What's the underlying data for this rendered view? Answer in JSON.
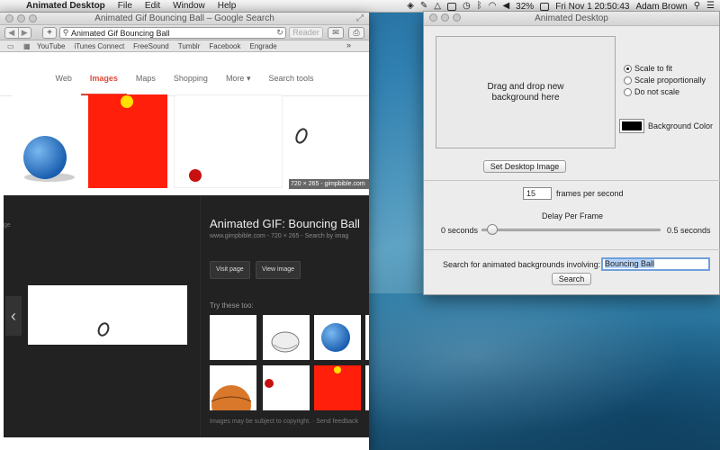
{
  "menubar": {
    "app_name": "Animated Desktop",
    "items": [
      "File",
      "Edit",
      "Window",
      "Help"
    ],
    "battery": "32%",
    "datetime": "Fri Nov 1  20:50:43",
    "user": "Adam Brown"
  },
  "browser": {
    "window_title": "Animated Gif Bouncing Ball – Google Search",
    "url_text": "Animated Gif Bouncing Ball",
    "reader_label": "Reader",
    "bookmarks": [
      "YouTube",
      "iTunes Connect",
      "FreeSound",
      "Tumblr",
      "Facebook",
      "Engrade"
    ],
    "google_tabs": [
      "Web",
      "Images",
      "Maps",
      "Shopping",
      "More ▾",
      "Search tools"
    ],
    "active_tab": "Images",
    "thumb_caption": "720 × 265 - gimpbible.com",
    "preview": {
      "left_edge_text": "ge",
      "title": "Animated GIF: Bouncing Ball",
      "subtitle": "www.gimpbible.com - 720 × 265 - Search by imag",
      "visit_label": "Visit page",
      "view_label": "View image",
      "try_these": "Try these too:",
      "footer": "Images may be subject to copyright.  ·  Send feedback"
    }
  },
  "desktop_app": {
    "window_title": "Animated Desktop",
    "dropzone_text": "Drag and drop new background here",
    "scale_options": [
      "Scale to fit",
      "Scale proportionally",
      "Do not scale"
    ],
    "selected_scale": 0,
    "background_color_label": "Background Color",
    "background_color": "#000000",
    "set_button": "Set Desktop Image",
    "fps_value": "15",
    "fps_label": "frames per second",
    "delay_label": "Delay Per Frame",
    "slider_min": "0 seconds",
    "slider_max": "0.5 seconds",
    "slider_value": 0.03,
    "search_label": "Search for animated backgrounds involving:",
    "search_value": "Bouncing Ball",
    "search_button": "Search"
  },
  "colors": {
    "accent_red": "#dd4b39",
    "red_image": "#ff1f0a",
    "ball_blue": "#2a7ad0",
    "ball_yellow": "#ffe000"
  }
}
